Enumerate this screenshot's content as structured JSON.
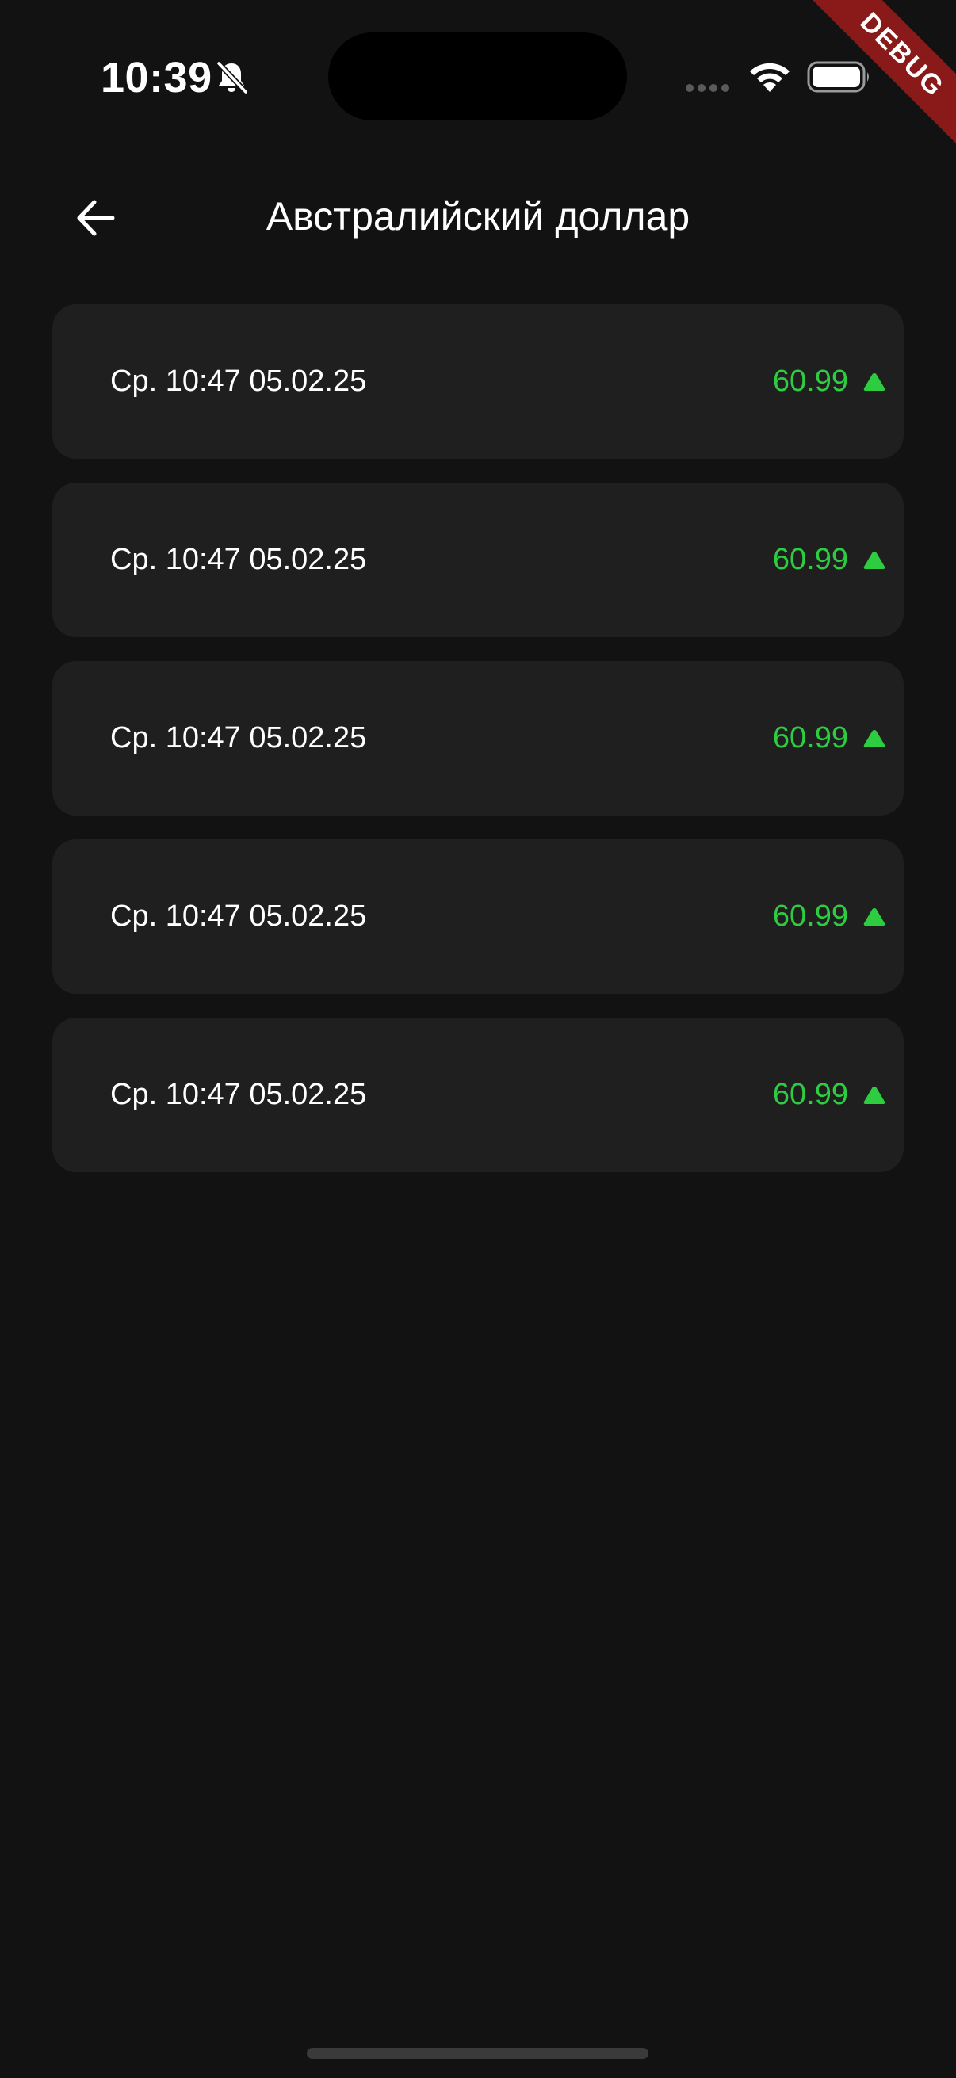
{
  "status_bar": {
    "time": "10:39",
    "icons": [
      "bell-slash-icon",
      "signal-dots-icon",
      "wifi-icon",
      "battery-icon"
    ]
  },
  "debug_banner": {
    "label": "DEBUG",
    "color": "#8a1a1a"
  },
  "app_bar": {
    "back_icon": "arrow-left-icon",
    "title": "Австралийский доллар"
  },
  "rates": [
    {
      "date": "Ср. 10:47 05.02.25",
      "value": "60.99",
      "trend": "up-triangle-icon"
    },
    {
      "date": "Ср. 10:47 05.02.25",
      "value": "60.99",
      "trend": "up-triangle-icon"
    },
    {
      "date": "Ср. 10:47 05.02.25",
      "value": "60.99",
      "trend": "up-triangle-icon"
    },
    {
      "date": "Ср. 10:47 05.02.25",
      "value": "60.99",
      "trend": "up-triangle-icon"
    },
    {
      "date": "Ср. 10:47 05.02.25",
      "value": "60.99",
      "trend": "up-triangle-icon"
    }
  ],
  "colors": {
    "background": "#121212",
    "card": "#1f1f1f",
    "positive": "#2ecc40",
    "text": "#ffffff"
  }
}
